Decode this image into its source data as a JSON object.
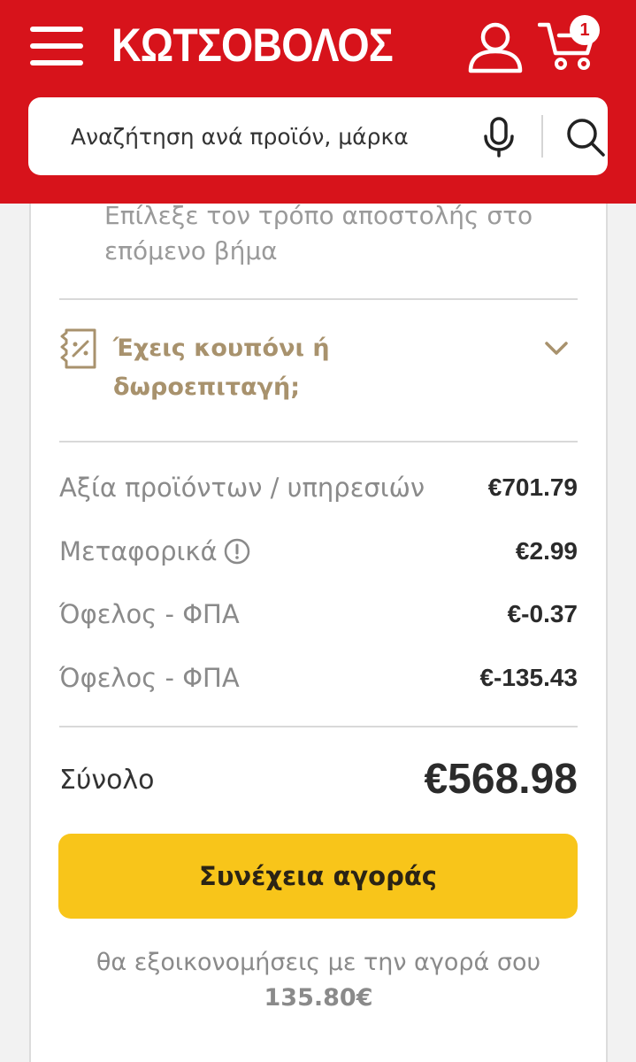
{
  "header": {
    "logo_text": "ΚΩΤΣΟΒΟΛΟΣ",
    "cart_count": "1",
    "brand_color": "#d7131b",
    "icons": [
      "menu-icon",
      "account-icon",
      "cart-icon",
      "mic-icon",
      "search-icon"
    ]
  },
  "search": {
    "placeholder": "Αναζήτηση ανά προϊόν, μάρκα"
  },
  "summary": {
    "shipping_note": "Επίλεξε τον τρόπο αποστολής στο επόμενο βήμα",
    "coupon_label": "Έχεις κουπόνι ή δωροεπιταγή;",
    "coupon_color": "#a8926d",
    "rows": [
      {
        "label": "Αξία προϊόντων / υπηρεσιών",
        "value": "€701.79"
      },
      {
        "label": "Μεταφορικά",
        "value": "€2.99"
      },
      {
        "label": "Όφελος - ΦΠΑ",
        "value": "€-0.37"
      },
      {
        "label": "Όφελος - ΦΠΑ",
        "value": "€-135.43"
      }
    ],
    "total_label": "Σύνολο",
    "total_value": "€568.98",
    "cta_label": "Συνέχεια αγοράς",
    "cta_color": "#f8c51a",
    "savings_text": "θα εξοικονομήσεις με την αγορά σου",
    "savings_amount": "135.80€"
  }
}
